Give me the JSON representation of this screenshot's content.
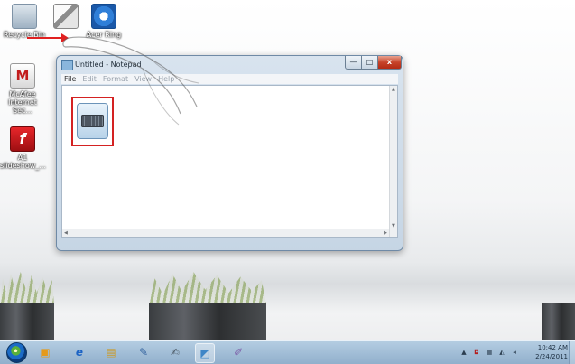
{
  "desktop": {
    "icons": [
      {
        "label": "Recycle Bin",
        "icon": "recycle-bin-icon"
      },
      {
        "label": "",
        "icon": "application-icon"
      },
      {
        "label": "Acer Ring",
        "icon": "acer-ring-icon"
      },
      {
        "label": "McAfee Internet Sec...",
        "icon": "mcafee-icon",
        "glyph": "M"
      },
      {
        "label": "A1 slideshow_...",
        "icon": "flash-icon",
        "glyph": "f"
      }
    ]
  },
  "notepad": {
    "title": "Untitled - Notepad",
    "menu": [
      "File",
      "Edit",
      "Format",
      "View",
      "Help"
    ],
    "buttons": {
      "minimize": "—",
      "maximize": "□",
      "close": "x"
    }
  },
  "callout": {
    "icon": "on-screen-keyboard-icon",
    "highlight_color": "#d42222"
  },
  "taskbar": {
    "pinned": [
      {
        "icon": "windows-media-center-icon",
        "glyph": "▣"
      },
      {
        "icon": "internet-explorer-icon",
        "glyph": "e"
      },
      {
        "icon": "windows-explorer-icon",
        "glyph": "▤"
      },
      {
        "icon": "paint-icon",
        "glyph": "✎"
      },
      {
        "icon": "handwriting-icon",
        "glyph": "✍"
      },
      {
        "icon": "sticky-notes-icon",
        "glyph": "◩"
      },
      {
        "icon": "paintbrush-icon",
        "glyph": "✐"
      }
    ],
    "tray": [
      "▲",
      "◘",
      "▦",
      "◭",
      "◂"
    ],
    "clock": {
      "time": "10:42 AM",
      "date": "2/24/2011"
    }
  },
  "colors": {
    "accent": "#d42222",
    "taskbar": "#8cacca",
    "window_frame": "#c4d4e4"
  }
}
